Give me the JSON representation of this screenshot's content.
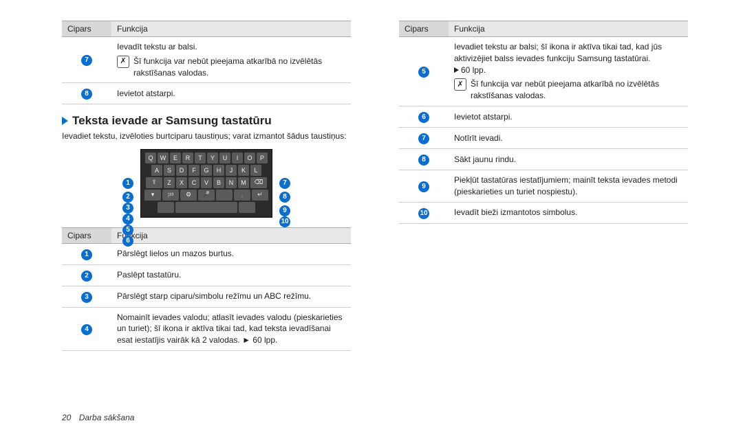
{
  "headers": {
    "cipars": "Cipars",
    "funkcija": "Funkcija"
  },
  "note_glyph": "✗",
  "leftTopTable": {
    "rows": [
      {
        "num": "7",
        "lines": [
          {
            "text": "Ievadīt tekstu ar balsi."
          },
          {
            "note": true,
            "text": "Šī funkcija var nebūt pieejama atkarībā no izvēlētās rakstīšanas valodas."
          }
        ]
      },
      {
        "num": "8",
        "lines": [
          {
            "text": "Ievietot atstarpi."
          }
        ]
      }
    ]
  },
  "section": {
    "title": "Teksta ievade ar Samsung tastatūru",
    "intro": "Ievadiet tekstu, izvēloties burtciparu taustiņus; varat izmantot šādus taustiņus:"
  },
  "keyboard": {
    "row1": [
      "Q",
      "W",
      "E",
      "R",
      "T",
      "Y",
      "U",
      "I",
      "O",
      "P"
    ],
    "row2": [
      "A",
      "S",
      "D",
      "F",
      "G",
      "H",
      "J",
      "K",
      "L"
    ],
    "row3_mid": [
      "Z",
      "X",
      "C",
      "V",
      "B",
      "N",
      "M"
    ],
    "shift": "⇧",
    "back": "⌫",
    "hide": "▾",
    "mode": "⁞²³",
    "lang": "⚙",
    "voice": "🎤",
    "space": " ",
    "dot": ".",
    "enter": "↵"
  },
  "leftBottomTable": {
    "rows": [
      {
        "num": "1",
        "text": "Pārslēgt lielos un mazos burtus."
      },
      {
        "num": "2",
        "text": "Paslēpt tastatūru."
      },
      {
        "num": "3",
        "text": "Pārslēgt starp ciparu/simbolu režīmu un ABC režīmu."
      },
      {
        "num": "4",
        "text": "Nomainīt ievades valodu; atlasīt ievades valodu (pieskarieties un turiet); šī ikona ir aktīva tikai tad, kad teksta ievadīšanai esat iestatījis vairāk kā 2 valodas. ► 60 lpp."
      }
    ]
  },
  "rightTable": {
    "rows": [
      {
        "num": "5",
        "lines": [
          {
            "text": "Ievadiet tekstu ar balsi; šī ikona ir aktīva tikai tad, kad jūs aktivizējiet balss ievades funkciju Samsung tastatūrai."
          },
          {
            "link": true,
            "text": "60 lpp."
          },
          {
            "note": true,
            "text": "Šī funkcija var nebūt pieejama atkarībā no izvēlētās rakstīšanas valodas."
          }
        ]
      },
      {
        "num": "6",
        "lines": [
          {
            "text": "Ievietot atstarpi."
          }
        ]
      },
      {
        "num": "7",
        "lines": [
          {
            "text": "Notīrīt ievadi."
          }
        ]
      },
      {
        "num": "8",
        "lines": [
          {
            "text": "Sākt jaunu rindu."
          }
        ]
      },
      {
        "num": "9",
        "lines": [
          {
            "text": "Piekļūt tastatūras iestatījumiem; mainīt teksta ievades metodi (pieskarieties un turiet nospiestu)."
          }
        ]
      },
      {
        "num": "10",
        "lines": [
          {
            "text": "Ievadīt bieži izmantotos simbolus."
          }
        ]
      }
    ]
  },
  "footer": {
    "page": "20",
    "section": "Darba sākšana"
  }
}
